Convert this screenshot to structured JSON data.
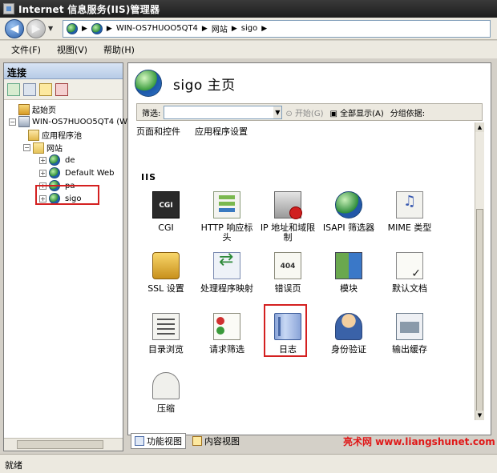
{
  "window": {
    "title": "Internet 信息服务(IIS)管理器"
  },
  "address": {
    "crumbs": [
      "WIN-OS7HUOO5QT4",
      "网站",
      "sigo"
    ]
  },
  "menu": {
    "items": [
      "文件(F)",
      "视图(V)",
      "帮助(H)"
    ]
  },
  "connections": {
    "title": "连接",
    "tree": {
      "start_page": "起始页",
      "server": "WIN-OS7HUOO5QT4 (W",
      "app_pools": "应用程序池",
      "sites": "网站",
      "site_items": [
        "de",
        "Default Web",
        "pa",
        "sigo"
      ]
    }
  },
  "main": {
    "page_title": "sigo 主页",
    "filter": {
      "label": "筛选:",
      "start_label": "开始(G)",
      "show_all_label": "全部显示(A)",
      "group_by_label": "分组依据:"
    },
    "top_items": [
      "页面和控件",
      "应用程序设置"
    ],
    "section_title": "IIS",
    "features": [
      {
        "label": "CGI",
        "icon": "cgi-icon"
      },
      {
        "label": "HTTP 响应标头",
        "icon": "http-response-headers-icon"
      },
      {
        "label": "IP 地址和域限制",
        "icon": "ip-domain-restrictions-icon"
      },
      {
        "label": "ISAPI 筛选器",
        "icon": "isapi-filters-icon"
      },
      {
        "label": "MIME 类型",
        "icon": "mime-types-icon"
      },
      {
        "label": "SSL 设置",
        "icon": "ssl-settings-icon"
      },
      {
        "label": "处理程序映射",
        "icon": "handler-mappings-icon"
      },
      {
        "label": "错误页",
        "icon": "error-pages-icon"
      },
      {
        "label": "模块",
        "icon": "modules-icon"
      },
      {
        "label": "默认文档",
        "icon": "default-document-icon"
      },
      {
        "label": "目录浏览",
        "icon": "directory-browsing-icon"
      },
      {
        "label": "请求筛选",
        "icon": "request-filtering-icon"
      },
      {
        "label": "日志",
        "icon": "logging-icon"
      },
      {
        "label": "身份验证",
        "icon": "authentication-icon"
      },
      {
        "label": "输出缓存",
        "icon": "output-caching-icon"
      },
      {
        "label": "压缩",
        "icon": "compression-icon"
      }
    ],
    "icon_text": {
      "cgi": "CGI",
      "error": "404"
    }
  },
  "view_tabs": {
    "features": "功能视图",
    "content": "内容视图"
  },
  "watermark": "亮术网 www.liangshunet.com",
  "status": {
    "text": "就绪"
  },
  "colors": {
    "highlight": "#d42020",
    "title_bar": "#1c1c1c"
  }
}
